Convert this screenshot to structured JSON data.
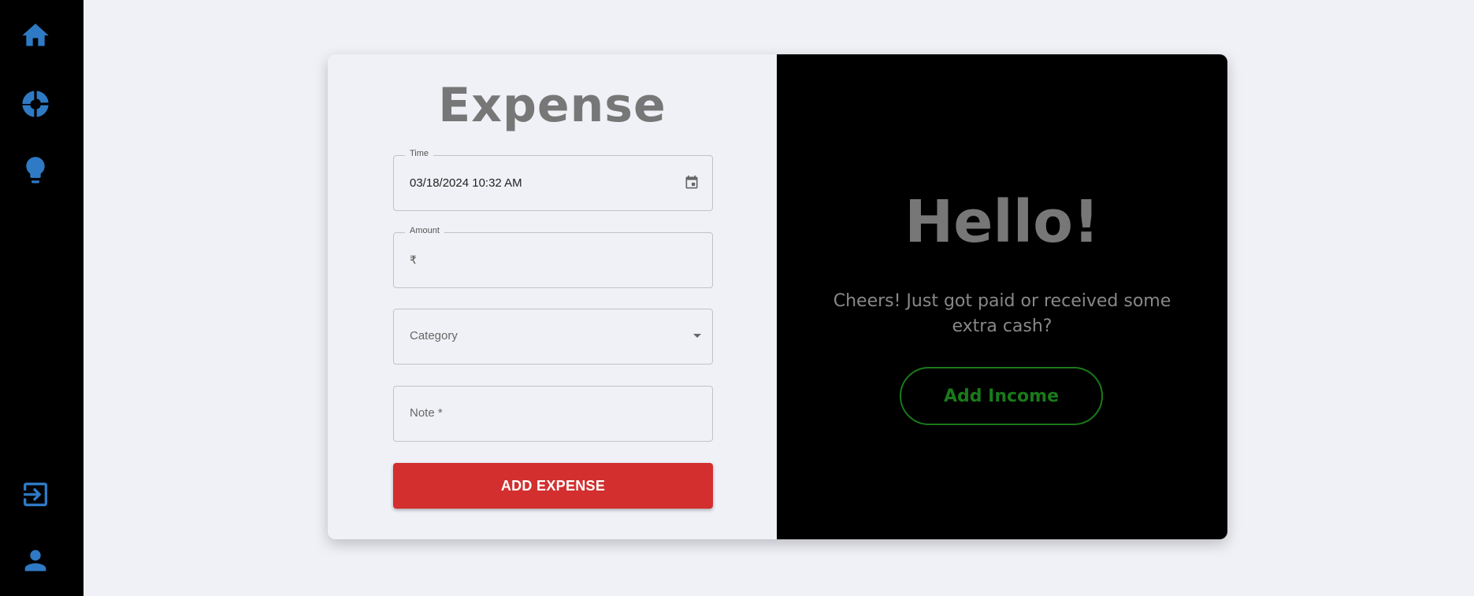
{
  "sidebar": {
    "items": [
      {
        "icon": "home-icon"
      },
      {
        "icon": "pie-chart-icon"
      },
      {
        "icon": "lightbulb-icon"
      },
      {
        "icon": "logout-icon"
      },
      {
        "icon": "user-icon"
      }
    ],
    "icon_color": "#2f7ac4"
  },
  "expense_form": {
    "title": "Expense",
    "time": {
      "label": "Time",
      "value": "03/18/2024 10:32 AM"
    },
    "amount": {
      "label": "Amount",
      "prefix": "₹",
      "value": ""
    },
    "category": {
      "placeholder": "Category",
      "value": ""
    },
    "note": {
      "placeholder": "Note *",
      "value": ""
    },
    "submit_label": "ADD EXPENSE",
    "submit_color": "#d32f2f"
  },
  "income_panel": {
    "heading": "Hello!",
    "message": "Cheers! Just got paid or received some extra cash?",
    "button_label": "Add Income",
    "accent_color": "#1a7a1a"
  }
}
